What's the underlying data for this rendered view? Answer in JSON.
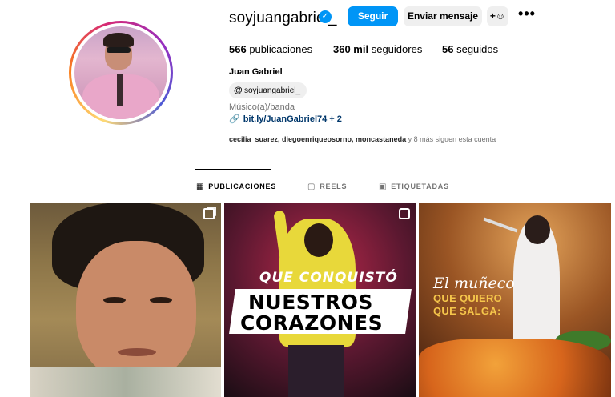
{
  "profile": {
    "username": "soyjuangabriel_",
    "verified": true,
    "follow_label": "Seguir",
    "message_label": "Enviar mensaje",
    "add_user_icon": "add-user-icon",
    "more_icon": "more-options-icon",
    "more_glyph": "•••",
    "stats": {
      "posts_count": "566",
      "posts_label": "publicaciones",
      "followers_count": "360 mil",
      "followers_label": "seguidores",
      "following_count": "56",
      "following_label": "seguidos"
    },
    "full_name": "Juan Gabriel",
    "threads_handle": "soyjuangabriel_",
    "category": "Músico(a)/banda",
    "link": "bit.ly/JuanGabriel74 + 2",
    "followed_by_names": "cecilia_suarez, diegoenriqueosorno, moncastaneda",
    "followed_by_suffix": " y 8 más siguen esta cuenta"
  },
  "tabs": [
    {
      "label": "PUBLICACIONES",
      "icon": "grid-icon",
      "active": true
    },
    {
      "label": "REELS",
      "icon": "reels-icon",
      "active": false
    },
    {
      "label": "ETIQUETADAS",
      "icon": "tagged-icon",
      "active": false
    }
  ],
  "posts": [
    {
      "type": "carousel",
      "overlay_text": []
    },
    {
      "type": "reel",
      "overlay_text": [
        "QUE CONQUISTÓ",
        "NUESTROS",
        "CORAZONES"
      ]
    },
    {
      "type": "image",
      "overlay_text": [
        "El muñeco",
        "QUE QUIERO",
        "QUE SALGA:"
      ]
    }
  ],
  "colors": {
    "accent": "#0095f6",
    "secondary_button": "#efefef",
    "muted_text": "#737373",
    "link_text": "#00376b"
  }
}
